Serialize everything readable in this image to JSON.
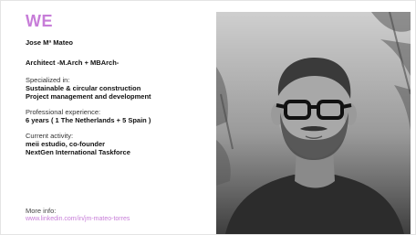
{
  "heading": "WE",
  "profile": {
    "name": "Jose Mª Mateo",
    "title": "Architect -M.Arch + MBArch-",
    "specialized_label": "Specialized in:",
    "specialized_items": [
      "Sustainable & circular construction",
      "Project management and development"
    ],
    "experience_label": "Professional experience:",
    "experience_value": "6 years ( 1 The Netherlands + 5 Spain )",
    "activity_label": "Current activity:",
    "activity_items": [
      "meii estudio, co-founder",
      "NextGen International Taskforce"
    ],
    "more_label": "More info:",
    "more_link": "www.linkedin.com/in/jm-mateo-torres"
  },
  "colors": {
    "accent": "#c77dd8",
    "text": "#111111"
  },
  "photo": {
    "icon": "portrait-photo"
  }
}
